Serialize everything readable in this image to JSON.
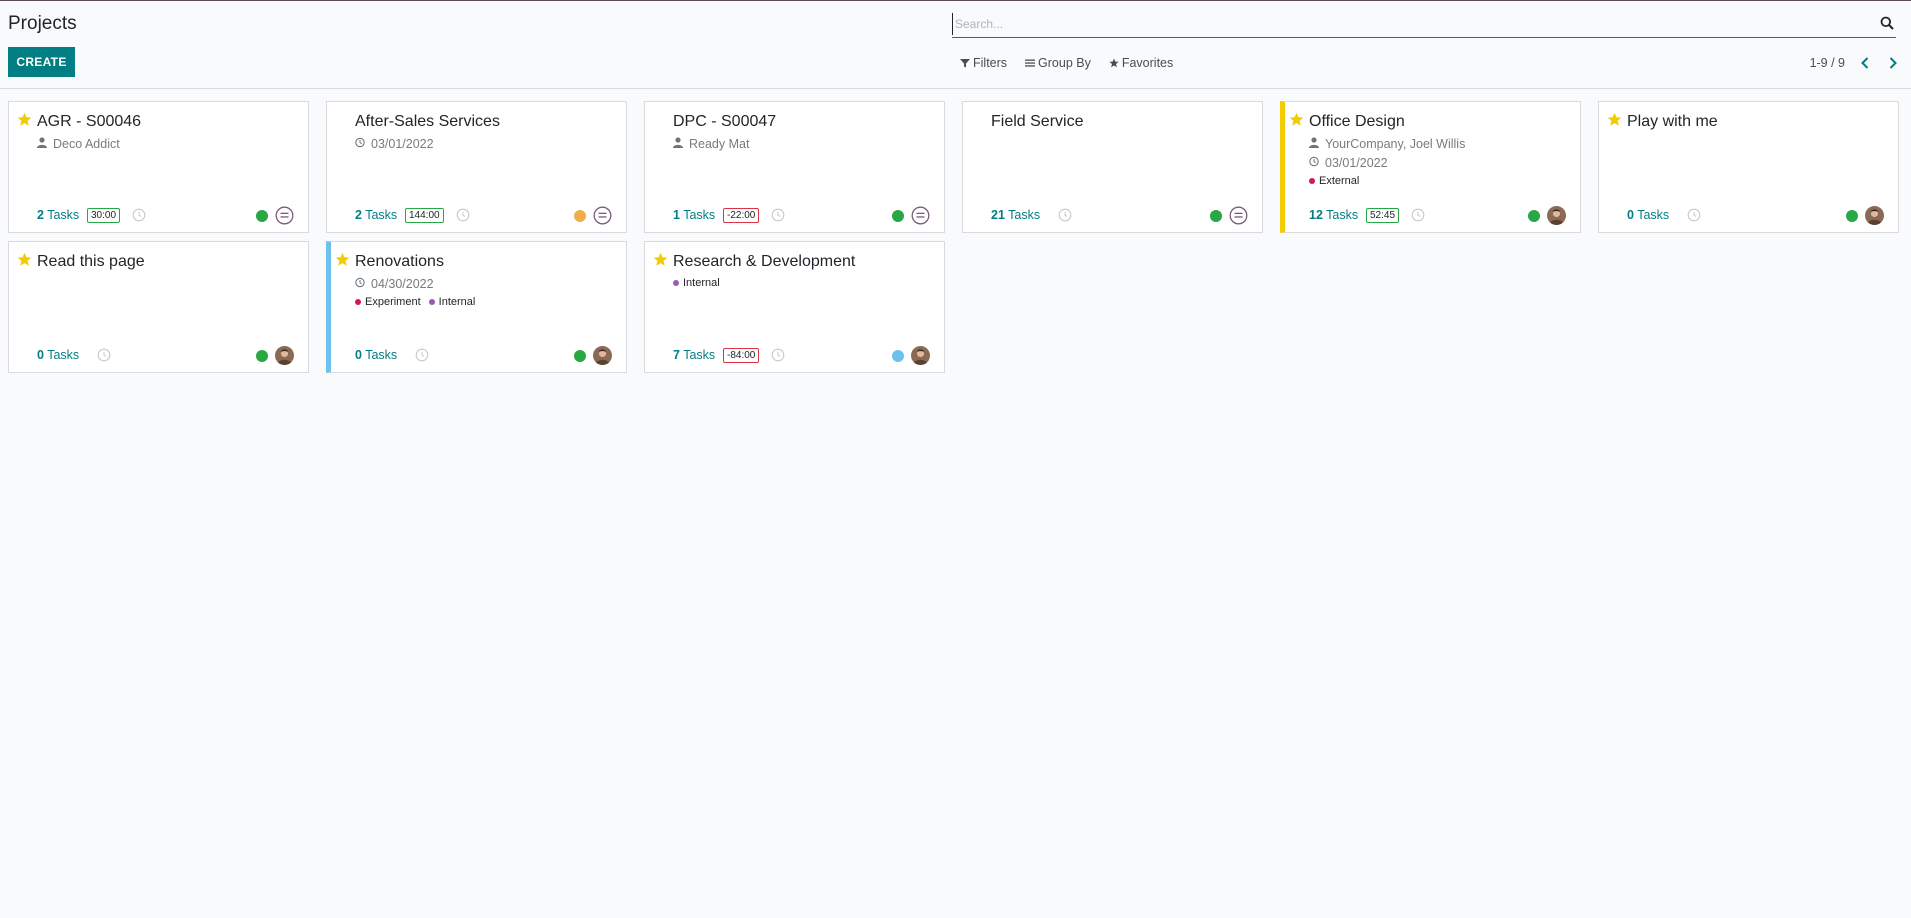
{
  "page": {
    "title": "Projects"
  },
  "toolbar": {
    "create_label": "CREATE"
  },
  "search": {
    "placeholder": "Search..."
  },
  "filters": {
    "filters_label": "Filters",
    "group_by_label": "Group By",
    "favorites_label": "Favorites"
  },
  "pager": {
    "value": "1-9 / 9"
  },
  "colors": {
    "brand": "#017e84",
    "star": "#f3cc00",
    "status_green": "#28a745",
    "status_orange": "#f0ad4e",
    "status_blue": "#6cc1ed"
  },
  "projects": [
    {
      "title": "AGR - S00046",
      "favorite": true,
      "partner": "Deco Addict",
      "task_count": "2",
      "tasks_label": " Tasks",
      "hours": "30:00",
      "hours_negative": false,
      "status": "green",
      "avatar": "placeholder"
    },
    {
      "title": "After-Sales Services",
      "favorite": false,
      "date": "03/01/2022",
      "task_count": "2",
      "tasks_label": " Tasks",
      "hours": "144:00",
      "hours_negative": false,
      "status": "orange",
      "avatar": "placeholder"
    },
    {
      "title": "DPC - S00047",
      "favorite": false,
      "partner": "Ready Mat",
      "task_count": "1",
      "tasks_label": " Tasks",
      "hours": "-22:00",
      "hours_negative": true,
      "status": "green",
      "avatar": "placeholder"
    },
    {
      "title": "Field Service",
      "favorite": false,
      "task_count": "21",
      "tasks_label": " Tasks",
      "status": "green",
      "avatar": "placeholder"
    },
    {
      "title": "Office Design",
      "favorite": true,
      "accent": "yellow",
      "partner": "YourCompany, Joel Willis",
      "date": "03/01/2022",
      "tags": [
        {
          "label": "External",
          "color": "#d6145f"
        }
      ],
      "task_count": "12",
      "tasks_label": " Tasks",
      "hours": "52:45",
      "hours_negative": false,
      "status": "green",
      "avatar": "photo"
    },
    {
      "title": "Play with me",
      "favorite": true,
      "task_count": "0",
      "tasks_label": " Tasks",
      "status": "green",
      "avatar": "photo"
    },
    {
      "title": "Read this page",
      "favorite": true,
      "task_count": "0",
      "tasks_label": " Tasks",
      "status": "green",
      "avatar": "photo"
    },
    {
      "title": "Renovations",
      "favorite": true,
      "accent": "blue",
      "date": "04/30/2022",
      "tags": [
        {
          "label": "Experiment",
          "color": "#d6145f"
        },
        {
          "label": "Internal",
          "color": "#9b59b6"
        }
      ],
      "task_count": "0",
      "tasks_label": " Tasks",
      "status": "green",
      "avatar": "photo"
    },
    {
      "title": "Research & Development",
      "favorite": true,
      "tags": [
        {
          "label": "Internal",
          "color": "#9b59b6"
        }
      ],
      "task_count": "7",
      "tasks_label": " Tasks",
      "hours": "-84:00",
      "hours_negative": true,
      "status": "blue",
      "avatar": "photo"
    }
  ]
}
